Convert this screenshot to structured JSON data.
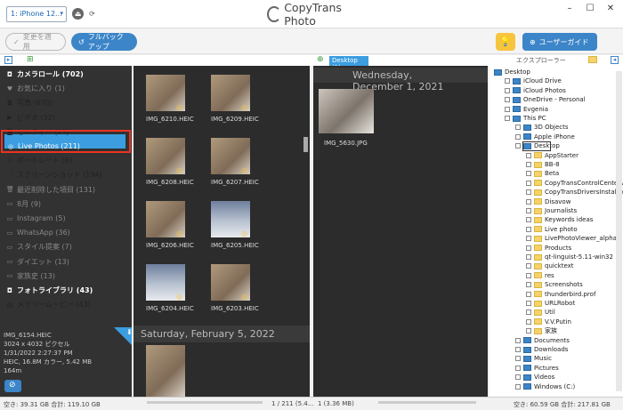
{
  "app": {
    "title": "CopyTrans Photo",
    "device": "1: iPhone 12..."
  },
  "toolbar": {
    "apply": "変更を適用",
    "rollback": "フルバックアップ",
    "guide": "ユーザーガイド"
  },
  "left": {
    "items": [
      {
        "label": "カメラロール (702)",
        "style": "bold",
        "icon": "camera-icon"
      },
      {
        "label": "お気に入り (1)",
        "style": "dim",
        "icon": "heart-icon"
      },
      {
        "label": "写真 (670)",
        "style": "",
        "icon": "camera-icon"
      },
      {
        "label": "ビデオ (32)",
        "style": "",
        "icon": "video-icon"
      },
      {
        "label": "セルフィー (25)",
        "style": "",
        "icon": "selfie-icon"
      },
      {
        "label": "Live Photos (211)",
        "style": "sel",
        "icon": "live-icon"
      },
      {
        "label": "ポートレート (6)",
        "style": "",
        "icon": "portrait-icon"
      },
      {
        "label": "スクリーンショット (194)",
        "style": "",
        "icon": "screenshot-icon"
      },
      {
        "label": "最近削除した項目 (131)",
        "style": "dim",
        "icon": "trash-icon"
      },
      {
        "label": "8月 (9)",
        "style": "dim",
        "icon": "album-icon"
      },
      {
        "label": "Instagram (5)",
        "style": "dim",
        "icon": "album-icon"
      },
      {
        "label": "WhatsApp (36)",
        "style": "dim",
        "icon": "album-icon"
      },
      {
        "label": "スタイル提案 (7)",
        "style": "dim",
        "icon": "album-icon"
      },
      {
        "label": "ダイエット (13)",
        "style": "dim",
        "icon": "album-icon"
      },
      {
        "label": "家族史 (13)",
        "style": "dim",
        "icon": "album-icon"
      },
      {
        "label": "フォトライブラリ (43)",
        "style": "bold",
        "icon": "camera-icon"
      },
      {
        "label": "メモリームービー (43)",
        "style": "",
        "icon": "folder-icon"
      }
    ],
    "info": [
      "IMG_6154.HEIC",
      "3024 x 4032 ピクセル",
      "1/31/2022 2:27:37 PM",
      "HEIC, 16.8M カラー, 5.42 MB",
      "164m"
    ]
  },
  "middle": {
    "thumbs": [
      {
        "label": "IMG_6210.HEIC",
        "kind": "cat"
      },
      {
        "label": "IMG_6209.HEIC",
        "kind": "cat"
      },
      {
        "label": "IMG_6208.HEIC",
        "kind": "cat"
      },
      {
        "label": "IMG_6207.HEIC",
        "kind": "cat"
      },
      {
        "label": "IMG_6206.HEIC",
        "kind": "cat"
      },
      {
        "label": "IMG_6205.HEIC",
        "kind": "snow"
      },
      {
        "label": "IMG_6204.HEIC",
        "kind": "snow"
      },
      {
        "label": "IMG_6203.HEIC",
        "kind": "cat"
      }
    ],
    "date2": "Saturday, February 5, 2022",
    "count": "1 / 211 (5.4..."
  },
  "rightpanel": {
    "tab": "Desktop (1)",
    "date1": "Wednesday, December 1, 2021",
    "image": "IMG_5630.JPG",
    "count": "1 (3.36 MB)"
  },
  "explorer": {
    "label": "エクスプローラー",
    "nodes": [
      {
        "label": "Desktop",
        "icon": "blue",
        "depth": 0
      },
      {
        "label": "iCloud Drive",
        "icon": "blue",
        "depth": 1
      },
      {
        "label": "iCloud Photos",
        "icon": "blue",
        "depth": 1
      },
      {
        "label": "OneDrive - Personal",
        "icon": "blue",
        "depth": 1
      },
      {
        "label": "Evgenia",
        "icon": "blue",
        "depth": 1
      },
      {
        "label": "This PC",
        "icon": "blue",
        "depth": 1
      },
      {
        "label": "3D Objects",
        "icon": "blue",
        "depth": 2
      },
      {
        "label": "Apple iPhone",
        "icon": "blue",
        "depth": 2
      },
      {
        "label": "Desktop",
        "icon": "blue",
        "depth": 2
      },
      {
        "label": "AppStarter",
        "icon": "",
        "depth": 3
      },
      {
        "label": "BB-8",
        "icon": "",
        "depth": 3
      },
      {
        "label": "Beta",
        "icon": "",
        "depth": 3
      },
      {
        "label": "CopyTransControlCenterv5.00",
        "icon": "",
        "depth": 3
      },
      {
        "label": "CopyTransDriversInstallerJPv3",
        "icon": "",
        "depth": 3
      },
      {
        "label": "Disavow",
        "icon": "",
        "depth": 3
      },
      {
        "label": "Journalists",
        "icon": "",
        "depth": 3
      },
      {
        "label": "Keywords ideas",
        "icon": "",
        "depth": 3
      },
      {
        "label": "Live photo",
        "icon": "",
        "depth": 3
      },
      {
        "label": "LivePhotoViewer_alpha",
        "icon": "",
        "depth": 3
      },
      {
        "label": "Products",
        "icon": "",
        "depth": 3
      },
      {
        "label": "qt-linguist-5.11-win32",
        "icon": "",
        "depth": 3
      },
      {
        "label": "quicktext",
        "icon": "",
        "depth": 3
      },
      {
        "label": "res",
        "icon": "",
        "depth": 3
      },
      {
        "label": "Screenshots",
        "icon": "",
        "depth": 3
      },
      {
        "label": "thunderbird.prof",
        "icon": "",
        "depth": 3
      },
      {
        "label": "URLRobot",
        "icon": "",
        "depth": 3
      },
      {
        "label": "Util",
        "icon": "",
        "depth": 3
      },
      {
        "label": "V.V.Putin",
        "icon": "",
        "depth": 3
      },
      {
        "label": "家族",
        "icon": "",
        "depth": 3
      },
      {
        "label": "Documents",
        "icon": "blue",
        "depth": 2
      },
      {
        "label": "Downloads",
        "icon": "blue",
        "depth": 2
      },
      {
        "label": "Music",
        "icon": "blue",
        "depth": 2
      },
      {
        "label": "Pictures",
        "icon": "blue",
        "depth": 2
      },
      {
        "label": "Videos",
        "icon": "blue",
        "depth": 2
      },
      {
        "label": "Windows (C:)",
        "icon": "blue",
        "depth": 2
      }
    ]
  },
  "status": {
    "left": "空き: 39.31 GB 合計: 119.10 GB",
    "right": "空き: 60.59 GB 合計: 217.81 GB"
  },
  "colors": {
    "accent": "#3c85c8",
    "selected": "#3c9ee0",
    "highlight": "#e32222",
    "tip": "#f7c43d"
  }
}
